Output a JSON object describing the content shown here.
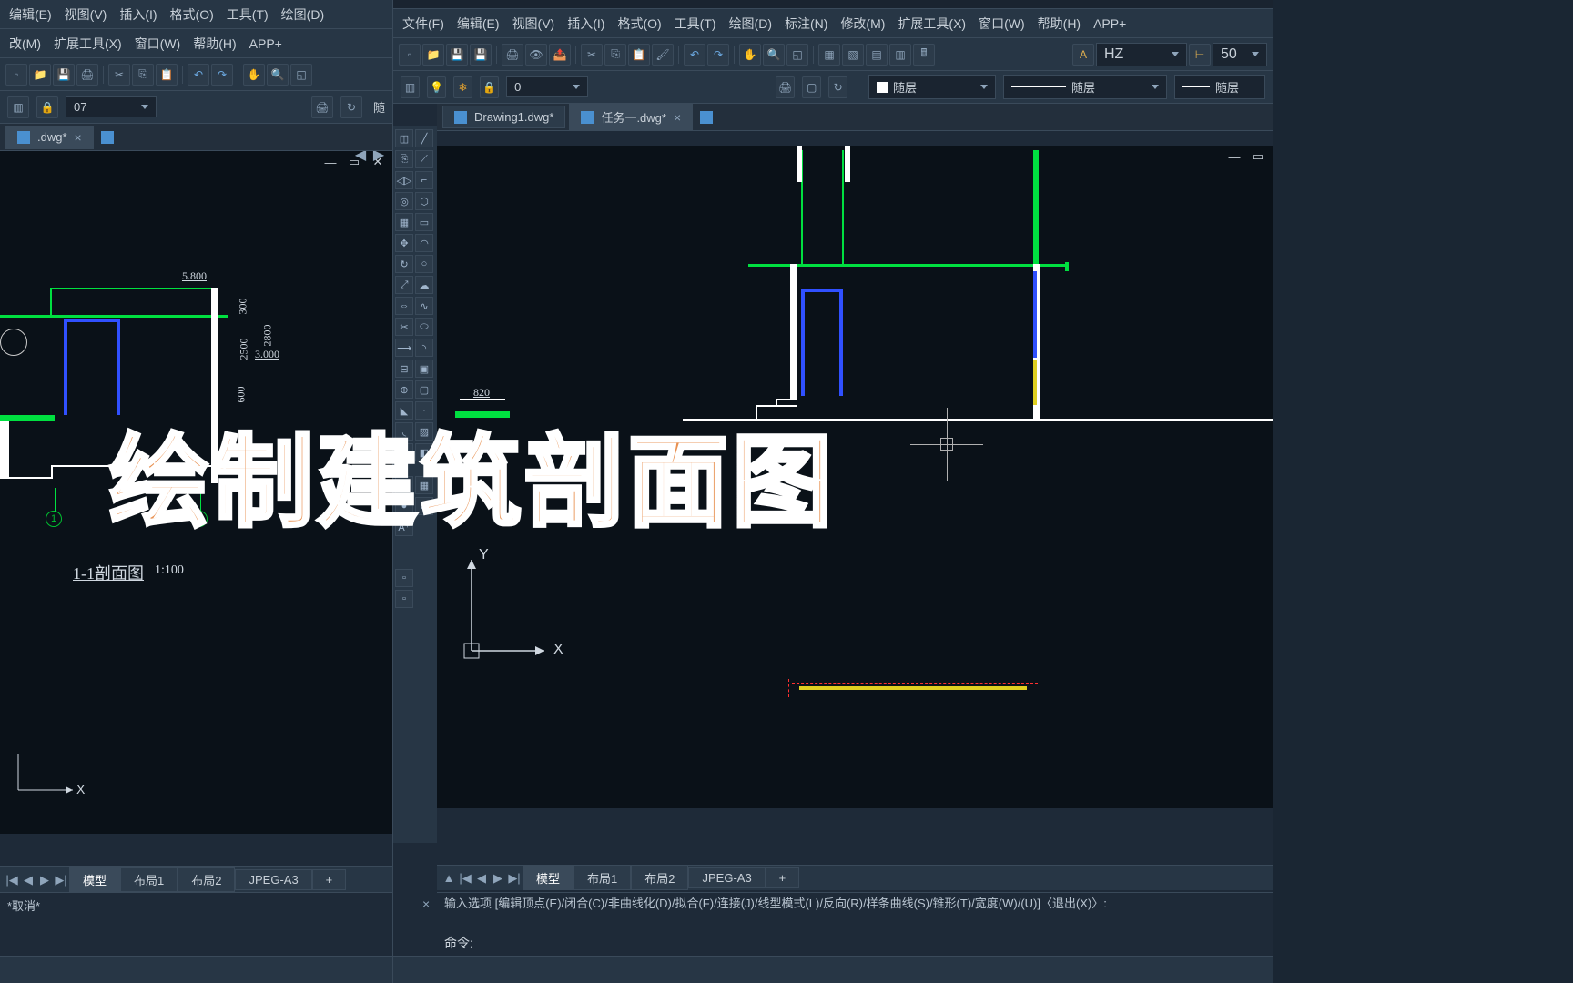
{
  "left": {
    "menu": [
      "编辑(E)",
      "视图(V)",
      "插入(I)",
      "格式(O)",
      "工具(T)",
      "绘图(D)"
    ],
    "menu2": [
      "改(M)",
      "扩展工具(X)",
      "窗口(W)",
      "帮助(H)",
      "APP+"
    ],
    "layer_value": "07",
    "bylayer": "随",
    "doc_tab": ".dwg*",
    "layout_tabs": [
      "模型",
      "布局1",
      "布局2",
      "JPEG-A3",
      "+"
    ],
    "cmd_history": "*取消*",
    "section_title": "1-1剖面图",
    "section_scale": "1:100",
    "dim1": "5.800",
    "dim2": "3.000",
    "d_300": "300",
    "d_2500": "2500",
    "d_2800": "2800",
    "d_600": "600",
    "marker1": "1",
    "marker2": "2",
    "axis_x": "X"
  },
  "right": {
    "menu": [
      "文件(F)",
      "编辑(E)",
      "视图(V)",
      "插入(I)",
      "格式(O)",
      "工具(T)",
      "绘图(D)",
      "标注(N)",
      "修改(M)",
      "扩展工具(X)",
      "窗口(W)",
      "帮助(H)",
      "APP+"
    ],
    "font_name": "HZ",
    "font_size": "50",
    "layer_value": "0",
    "bylayer_color": "随层",
    "bylayer_line": "随层",
    "bylayer_line2": "随层",
    "doc_tab1": "Drawing1.dwg*",
    "doc_tab2": "任务一.dwg*",
    "layout_tabs": [
      "模型",
      "布局1",
      "布局2",
      "JPEG-A3",
      "+"
    ],
    "cmd_history": "输入选项 [编辑顶点(E)/闭合(C)/非曲线化(D)/拟合(F)/连接(J)/线型模式(L)/反向(R)/样条曲线(S)/锥形(T)/宽度(W)/(U)]〈退出(X)〉:",
    "cmd_prompt": "命令:",
    "dim_820": "820",
    "axis_x": "X",
    "axis_y": "Y"
  },
  "overlay_title": "绘制建筑剖面图"
}
